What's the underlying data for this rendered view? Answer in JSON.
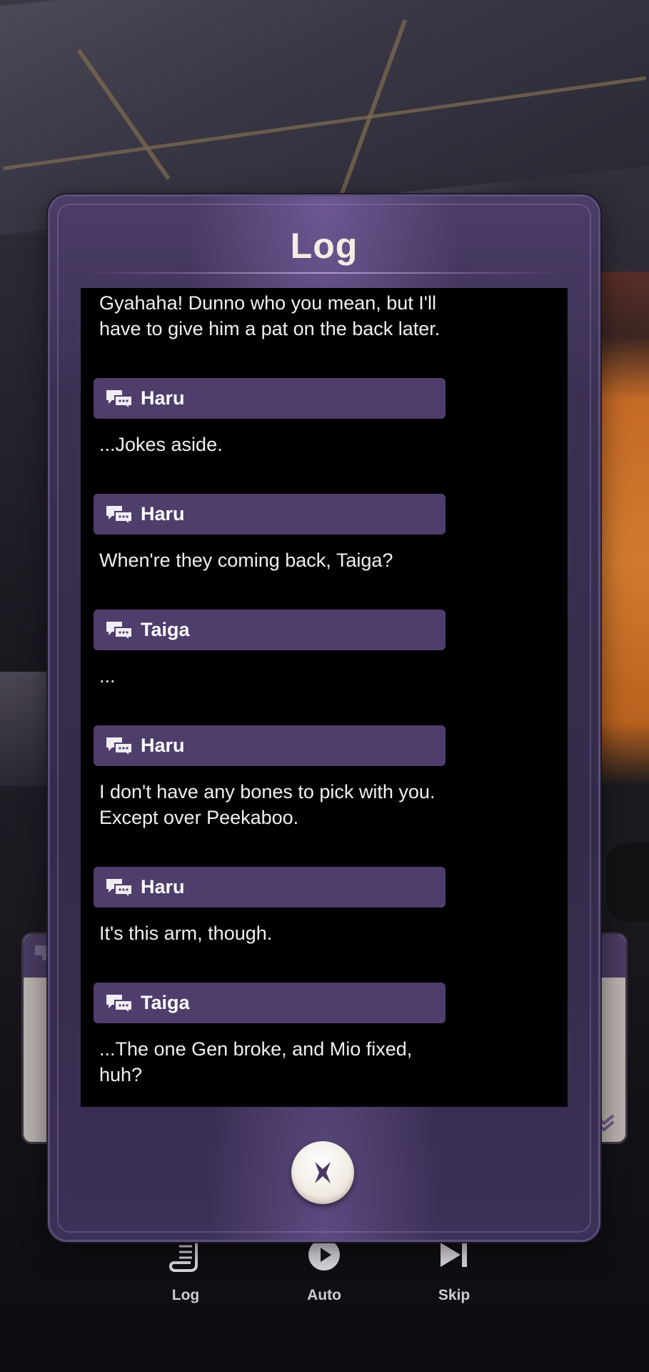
{
  "modal": {
    "title": "Log",
    "close_icon": "close-x-icon"
  },
  "log": {
    "first_line": "Gyahaha! Dunno who you mean, but I'll have to give him a pat on the back later.",
    "entries": [
      {
        "speaker": "Haru",
        "text": "...Jokes aside."
      },
      {
        "speaker": "Haru",
        "text": "When're they coming back, Taiga?"
      },
      {
        "speaker": "Taiga",
        "text": "..."
      },
      {
        "speaker": "Haru",
        "text": "I don't have any bones to pick with you. Except over Peekaboo."
      },
      {
        "speaker": "Haru",
        "text": "It's this arm, though."
      },
      {
        "speaker": "Taiga",
        "text": "...The one Gen broke, and Mio fixed, huh?"
      }
    ],
    "speaker_icon": "speech-bubbles-icon"
  },
  "toolbar": {
    "log_label": "Log",
    "auto_label": "Auto",
    "skip_label": "Skip",
    "log_icon": "scroll-icon",
    "auto_icon": "play-circle-icon",
    "skip_icon": "skip-forward-icon"
  },
  "colors": {
    "speaker_bar": "#4f3d6b",
    "modal_bg": "#3b3052",
    "log_bg": "#000000",
    "title_text": "#f3ede4"
  }
}
